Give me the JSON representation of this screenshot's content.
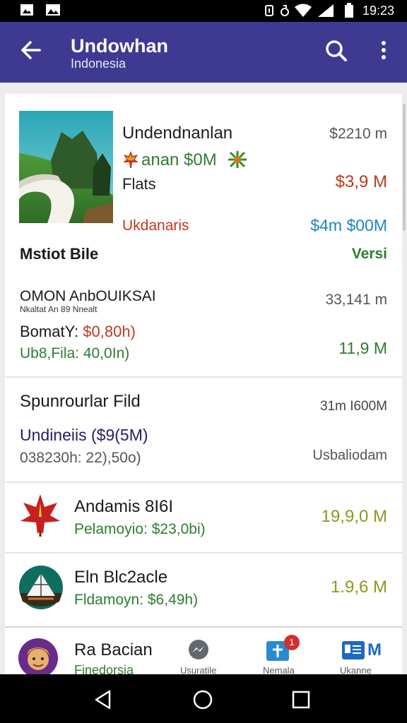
{
  "status_bar": {
    "time": "19:23"
  },
  "app_bar": {
    "title": "Undowhan",
    "subtitle": "Indonesia"
  },
  "featured": {
    "name": "Undendnanlan",
    "price_top": "$2210 m",
    "promo": "anan $0M",
    "type": "Flats",
    "value": "$3,9 M",
    "category": "Ukdanaris",
    "value2": "$4m $00M"
  },
  "section": {
    "title": "Mstiot Bile",
    "action": "Versi"
  },
  "listing1": {
    "name": "OMON AnbOUIKSAI",
    "sub": "Nkaltat An 89 Nnealt",
    "metric": "33,141 m",
    "price_line": "BomatY: $0,80h)",
    "price_line_label": "BomatY:",
    "price_line_value": "$0,80h)",
    "file_line": "Ub8,Fila: 40,0In)",
    "value": "11,9 M"
  },
  "listing2": {
    "name": "Spunrourlar Fild",
    "metric": "31m I600M",
    "price_line": "Undineiis ($9(5M)",
    "code_line": "038230h: 22),50o)",
    "location": "Usbaliodam"
  },
  "listing3": {
    "name": "Andamis 8I6I",
    "price_line": "Pelamoyio: $23,0bi)",
    "value": "19,9,0 M"
  },
  "listing4": {
    "name": "Eln Blc2acle",
    "price_line": "Fldamoyn: $6,49h)",
    "value": "1.9,6 M"
  },
  "bottom_profile": {
    "name": "Ra Bacian",
    "sub": "Finedorsia"
  },
  "bottom_tabs": [
    {
      "label": "Usuratile",
      "icon": "messenger-icon"
    },
    {
      "label": "Nemala",
      "icon": "map-pin-icon",
      "badge": "1"
    },
    {
      "label": "Ukanne",
      "icon": "document-icon",
      "icon_letter": "M"
    }
  ],
  "colors": {
    "app_bar": "#3e3a92",
    "price_red": "#c0391c",
    "price_blue": "#1b86c4",
    "price_green": "#2e7d32",
    "olive": "#8a9a1a",
    "purple": "#6a1b9a"
  }
}
